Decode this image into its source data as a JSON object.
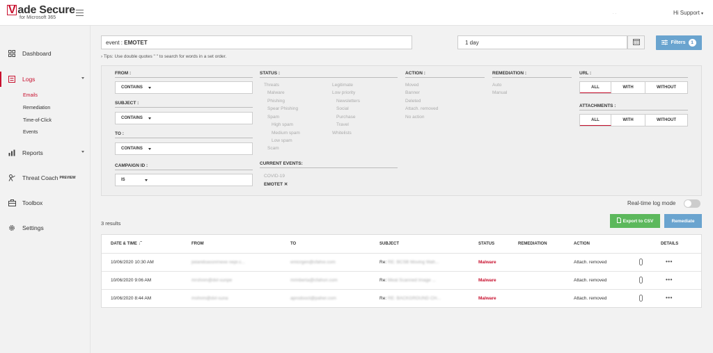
{
  "brand": {
    "name": "ade Secure",
    "v_letter": "V",
    "subtitle": "for Microsoft 365"
  },
  "user": {
    "greeting": "Hi Support"
  },
  "sidebar": {
    "items": [
      {
        "label": "Dashboard",
        "icon": "grid-icon"
      },
      {
        "label": "Logs",
        "icon": "list-icon",
        "active": true
      },
      {
        "label": "Reports",
        "icon": "chart-icon"
      },
      {
        "label": "Threat Coach",
        "icon": "coach-icon",
        "badge": "PREVIEW"
      },
      {
        "label": "Toolbox",
        "icon": "briefcase-icon"
      },
      {
        "label": "Settings",
        "icon": "gear-icon"
      }
    ],
    "logs_sub": [
      "Emails",
      "Remediation",
      "Time-of-Click",
      "Events"
    ]
  },
  "search": {
    "prefix": "event : ",
    "value": "EMOTET",
    "tips": "Tips: Use double quotes \" \" to search for words in a set order."
  },
  "date_range": {
    "value": "1 day"
  },
  "filters_btn": {
    "label": "Filters",
    "count": "1"
  },
  "filter_panel": {
    "from_label": "FROM :",
    "from_value": "CONTAINS",
    "subject_label": "SUBJECT :",
    "subject_value": "CONTAINS",
    "to_label": "TO :",
    "to_value": "CONTAINS",
    "campaign_label": "CAMPAIGN ID :",
    "campaign_value": "IS",
    "status_label": "STATUS :",
    "status_col1": [
      "Threats",
      "Malware",
      "Phishing",
      "Spear Phishing",
      "Spam",
      "High spam",
      "Medium spam",
      "Low spam",
      "Scam"
    ],
    "status_col2": [
      "Legitimate",
      "Low priority",
      "Newsletters",
      "Social",
      "Purchase",
      "Travel",
      "Whitelists"
    ],
    "current_events_label": "CURRENT EVENTS:",
    "current_events": [
      "COVID-19"
    ],
    "active_event": "EMOTET",
    "action_label": "ACTION :",
    "actions": [
      "Moved",
      "Banner",
      "Deleted",
      "Attach. removed",
      "No action"
    ],
    "remediation_label": "REMEDIATION :",
    "remediations": [
      "Auto",
      "Manual"
    ],
    "url_label": "URL :",
    "attachments_label": "ATTACHMENTS :",
    "seg_options": [
      "ALL",
      "WITH",
      "WITHOUT"
    ]
  },
  "realtime": {
    "label": "Real-time log mode"
  },
  "results": {
    "count_text": "3 results"
  },
  "buttons": {
    "export": "Export to CSV",
    "remediate": "Remediate"
  },
  "table": {
    "headers": [
      "DATE & TIME",
      "FROM",
      "TO",
      "SUBJECT",
      "STATUS",
      "REMEDIATION",
      "ACTION",
      "DETAILS"
    ],
    "rows": [
      {
        "date": "10/06/2020 10:30 AM",
        "from": "jwiandoassnrnexe nepr.c...",
        "to": "emicrgen@cfahsr.com",
        "subject_prefix": "Re: ",
        "subject": "RE: BCSB Moving Wah...",
        "status": "Malware",
        "action": "Attach. removed"
      },
      {
        "date": "10/06/2020 9:06 AM",
        "from": "mrshnm@dvl-sunpe",
        "to": "mrinberta@cfahsrr.com",
        "subject_prefix": "Re: ",
        "subject": "Meat Scanned Image ...",
        "status": "Malware",
        "action": "Attach. removed"
      },
      {
        "date": "10/06/2020 8:44 AM",
        "from": "mshnm@dvl-suna",
        "to": "aprodooct@paher.com",
        "subject_prefix": "Re: ",
        "subject": "RE: BACKGROUND CH...",
        "status": "Malware",
        "action": "Attach. removed"
      }
    ],
    "details_icon": "•••"
  },
  "colors": {
    "brand_red": "#c8102e",
    "accent_blue": "#6aa4cf",
    "export_green": "#5cb85c"
  }
}
